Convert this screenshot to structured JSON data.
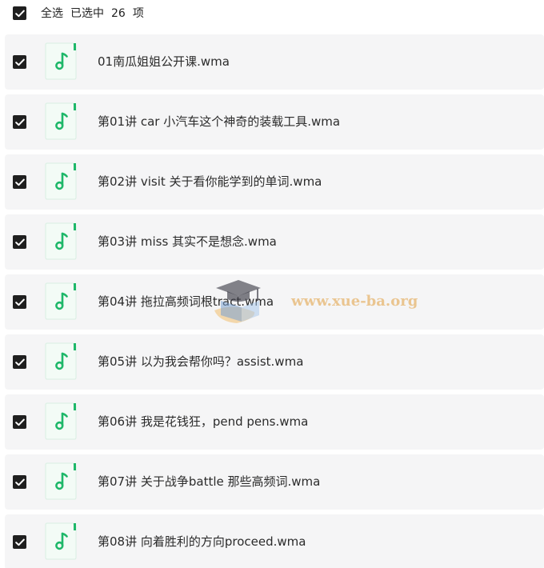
{
  "header": {
    "select_all_label": "全选",
    "selected_prefix": "已选中",
    "selected_count": "26",
    "selected_unit": "项",
    "checked": true
  },
  "files": [
    {
      "name": "01南瓜姐姐公开课.wma",
      "checked": true,
      "icon": "audio-file-icon"
    },
    {
      "name": "第01讲 car 小汽车这个神奇的装载工具.wma",
      "checked": true,
      "icon": "audio-file-icon"
    },
    {
      "name": "第02讲 visit 关于看你能学到的单词.wma",
      "checked": true,
      "icon": "audio-file-icon"
    },
    {
      "name": "第03讲 miss 其实不是想念.wma",
      "checked": true,
      "icon": "audio-file-icon"
    },
    {
      "name": "第04讲 拖拉高频词根tract.wma",
      "checked": true,
      "icon": "audio-file-icon"
    },
    {
      "name": "第05讲 以为我会帮你吗？assist.wma",
      "checked": true,
      "icon": "audio-file-icon"
    },
    {
      "name": "第06讲 我是花钱狂，pend pens.wma",
      "checked": true,
      "icon": "audio-file-icon"
    },
    {
      "name": "第07讲 关于战争battle 那些高频词.wma",
      "checked": true,
      "icon": "audio-file-icon"
    },
    {
      "name": "第08讲 向着胜利的方向proceed.wma",
      "checked": true,
      "icon": "audio-file-icon"
    }
  ],
  "watermark": {
    "text": "www.xue-ba.org"
  },
  "colors": {
    "checkbox": "#1f1f1f",
    "row_bg": "#f5f5f6",
    "audio_green": "#1fb86a",
    "icon_card": "#f3fbf6"
  }
}
